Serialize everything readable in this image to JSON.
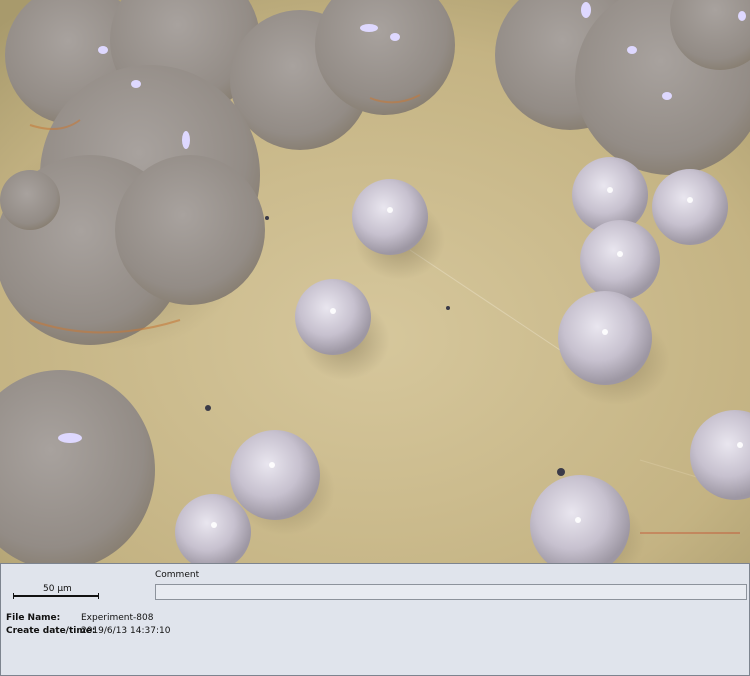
{
  "image": {
    "description_icon": "microscope-micrograph",
    "background_color": "#c8b88a"
  },
  "info_panel": {
    "scale_bar_label": "50 µm",
    "comment_label": "Comment",
    "comment_value": "",
    "file_name_label": "File Name:",
    "file_name_value": "Experiment-808",
    "create_date_label": "Create date/time:",
    "create_date_value": "2019/6/13 14:37:10"
  }
}
